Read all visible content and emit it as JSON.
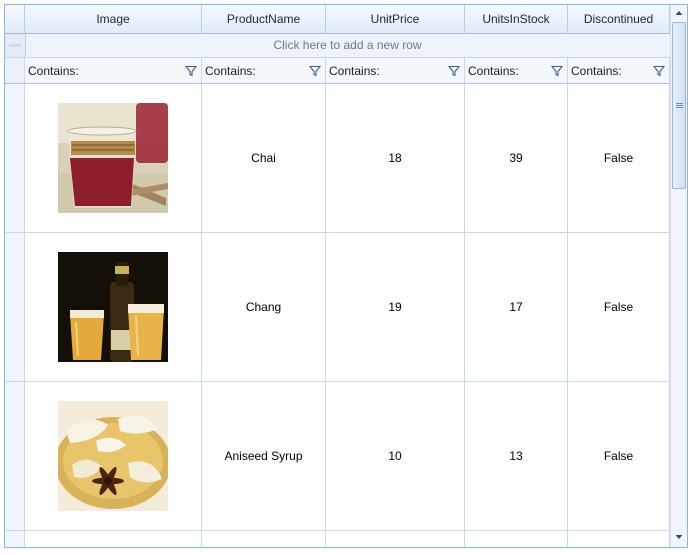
{
  "columns": [
    "Image",
    "ProductName",
    "UnitPrice",
    "UnitsInStock",
    "Discontinued"
  ],
  "new_row_text": "Click here to add a new row",
  "filter_label": "Contains:",
  "rows": [
    {
      "image": "chai-tea-glass-image",
      "ProductName": "Chai",
      "UnitPrice": "18",
      "UnitsInStock": "39",
      "Discontinued": "False"
    },
    {
      "image": "chang-beer-glasses-image",
      "ProductName": "Chang",
      "UnitPrice": "19",
      "UnitsInStock": "17",
      "Discontinued": "False"
    },
    {
      "image": "aniseed-syrup-bowl-image",
      "ProductName": "Aniseed Syrup",
      "UnitPrice": "10",
      "UnitsInStock": "13",
      "Discontinued": "False"
    }
  ],
  "colors": {
    "border": "#8db2e3",
    "header_bg": "#e1ebf7",
    "grid_line": "#c7d8ec"
  },
  "icons": [
    "filter-icon",
    "scroll-up-icon",
    "scroll-down-icon"
  ]
}
